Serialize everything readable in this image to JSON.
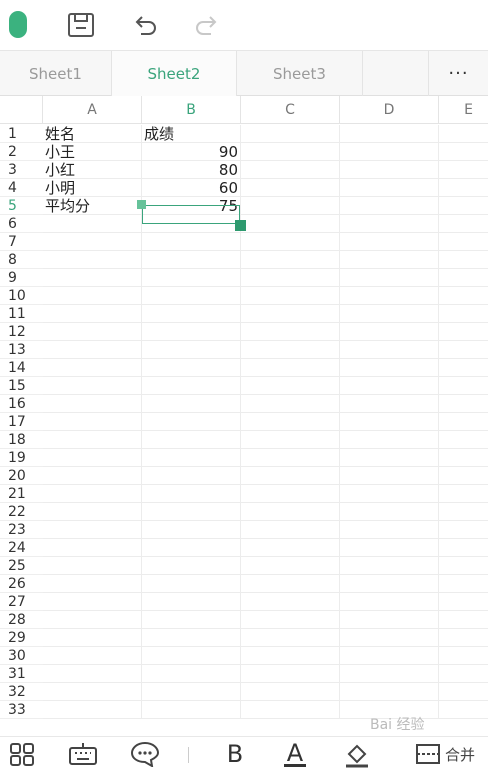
{
  "toolbar": {
    "icons": [
      "app-icon",
      "save-icon",
      "undo-icon",
      "redo-icon"
    ]
  },
  "sheet_tabs": [
    "Sheet1",
    "Sheet2",
    "Sheet3"
  ],
  "active_sheet": "Sheet2",
  "more_label": "···",
  "columns": [
    "A",
    "B",
    "C",
    "D",
    "E"
  ],
  "selected_column": "B",
  "rows": [
    {
      "num": "1",
      "a": "姓名",
      "b": "成绩"
    },
    {
      "num": "2",
      "a": "小王",
      "b": "90"
    },
    {
      "num": "3",
      "a": "小红",
      "b": "80"
    },
    {
      "num": "4",
      "a": "小明",
      "b": "60"
    },
    {
      "num": "5",
      "a": "平均分",
      "b": "75"
    },
    {
      "num": "6"
    },
    {
      "num": "7"
    },
    {
      "num": "8"
    },
    {
      "num": "9"
    },
    {
      "num": "10"
    },
    {
      "num": "11"
    },
    {
      "num": "12"
    },
    {
      "num": "13"
    },
    {
      "num": "14"
    },
    {
      "num": "15"
    },
    {
      "num": "16"
    },
    {
      "num": "17"
    },
    {
      "num": "18"
    },
    {
      "num": "19"
    },
    {
      "num": "20"
    },
    {
      "num": "21"
    },
    {
      "num": "22"
    },
    {
      "num": "23"
    },
    {
      "num": "24"
    },
    {
      "num": "25"
    },
    {
      "num": "26"
    },
    {
      "num": "27"
    },
    {
      "num": "28"
    },
    {
      "num": "29"
    },
    {
      "num": "30"
    },
    {
      "num": "31"
    },
    {
      "num": "32"
    },
    {
      "num": "33"
    }
  ],
  "selected_row": "5",
  "selected_cell": "B5",
  "bottom_toolbar": {
    "icons": [
      "grid-apps-icon",
      "keyboard-icon",
      "comment-icon",
      "bold-icon",
      "font-color-icon",
      "fill-icon",
      "merge-icon"
    ],
    "bold_label": "B",
    "font_color_label": "A",
    "merge_label": "合并"
  },
  "watermark": "Bai 经验",
  "colors": {
    "accent": "#3aa47c",
    "app_icon": "#3bb27f"
  }
}
